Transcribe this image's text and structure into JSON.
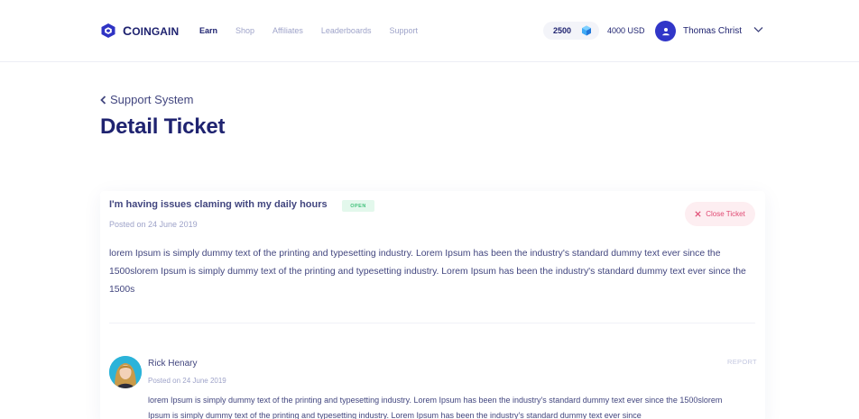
{
  "brand": {
    "initial": "C",
    "rest": "OINGAIN"
  },
  "nav": {
    "items": [
      {
        "label": "Earn"
      },
      {
        "label": "Shop"
      },
      {
        "label": "Affiliates"
      },
      {
        "label": "Leaderboards"
      },
      {
        "label": "Support"
      }
    ]
  },
  "balance": {
    "coins": "2500",
    "usd": "4000 USD",
    "gem_icon": "gem-icon"
  },
  "user": {
    "name": "Thomas Christ",
    "avatar_icon": "user-icon"
  },
  "page": {
    "back_label": "Support System",
    "title": "Detail Ticket"
  },
  "ticket": {
    "title": "I'm having issues claming with my daily hours",
    "status": "OPEN",
    "posted": "Posted on 24 June 2019",
    "close_label": "Close Ticket",
    "body": "lorem Ipsum is simply dummy text of the printing and typesetting industry. Lorem Ipsum has been the industry's standard dummy text ever since the 1500slorem Ipsum is simply dummy text of the printing and typesetting industry. Lorem Ipsum has been the industry's standard dummy text ever since the 1500s"
  },
  "reply": {
    "name": "Rick Henary",
    "posted": "Posted on 24 June 2019",
    "report_label": "REPORT",
    "text": "lorem Ipsum is simply dummy text of the printing and typesetting industry. Lorem Ipsum has been the industry's standard dummy text ever since the 1500slorem Ipsum is simply dummy text of the printing and typesetting industry. Lorem Ipsum has been the industry's standard dummy text ever since"
  },
  "colors": {
    "primary": "#1f2370",
    "accent": "#3136c8",
    "muted": "#9ea3c9",
    "status_open_bg": "#e3f8ec",
    "status_open_text": "#43c27c",
    "close_bg": "#fdeef1",
    "close_text": "#e04a73"
  }
}
